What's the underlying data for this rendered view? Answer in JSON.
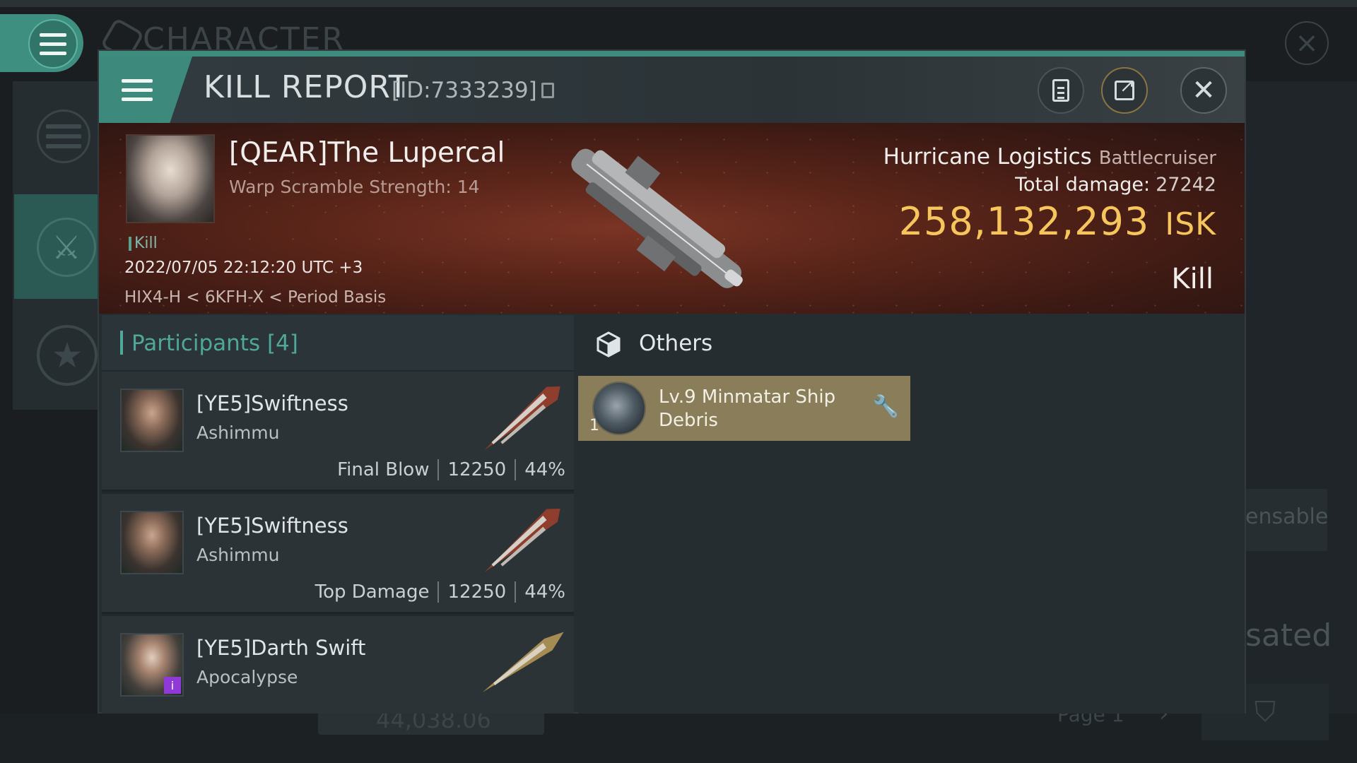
{
  "background": {
    "title": "CHARACTER",
    "right_text_1": "ensable",
    "right_text_2": "sated",
    "bottom_value": "44,038.06",
    "page_label": "Page 1"
  },
  "modal": {
    "title": "KILL REPORT",
    "report_id": "[ID:7333239]",
    "icons": {
      "menu": "hamburger-menu-icon",
      "notes": "clipboard-icon",
      "share": "share-icon",
      "close": "close-icon",
      "copy": "copy-icon"
    }
  },
  "victim": {
    "name": "[QEAR]The Lupercal",
    "scramble": "Warp Scramble Strength: 14",
    "kill_tag": "Kill",
    "datetime": "2022/07/05 22:12:20 UTC +3",
    "location": "HIX4-H < 6KFH-X < Period Basis"
  },
  "ship": {
    "name": "Hurricane Logistics",
    "class": "Battlecruiser",
    "total_damage_label": "Total damage:",
    "total_damage": "27242",
    "isk_value": "258,132,293",
    "isk_unit": "ISK",
    "result": "Kill"
  },
  "participants": {
    "title": "Participants [4]",
    "items": [
      {
        "name": "[YE5]Swiftness",
        "ship": "Ashimmu",
        "role": "Final Blow",
        "damage": "12250",
        "percent": "44%"
      },
      {
        "name": "[YE5]Swiftness",
        "ship": "Ashimmu",
        "role": "Top Damage",
        "damage": "12250",
        "percent": "44%"
      },
      {
        "name": "[YE5]Darth Swift",
        "ship": "Apocalypse",
        "role": "",
        "damage": "",
        "percent": ""
      }
    ]
  },
  "others": {
    "title": "Others",
    "loot": {
      "name": "Lv.9 Minmatar Ship Debris",
      "quantity": "1"
    }
  },
  "colors": {
    "accent_teal": "#3e8c7e",
    "isk_gold": "#f6c55c",
    "loot_card": "#8a7d5a"
  }
}
